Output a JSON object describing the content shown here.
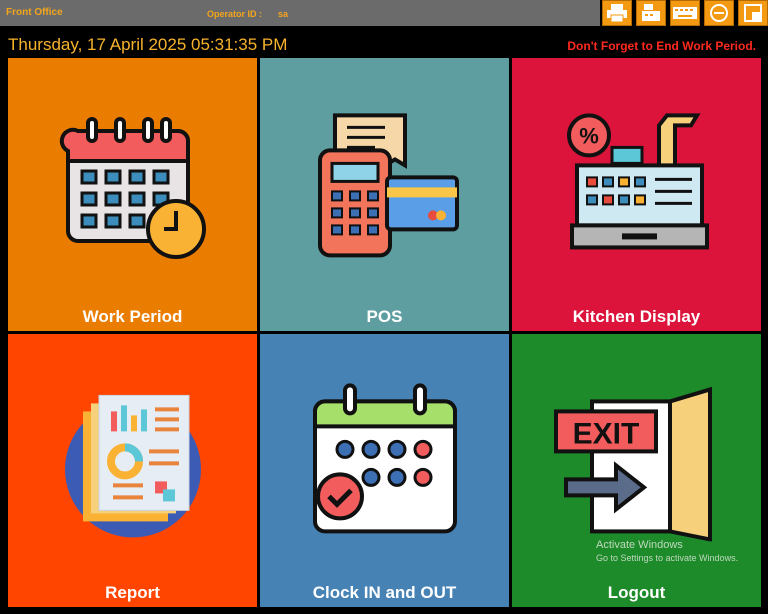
{
  "header": {
    "app_name": "Front Office",
    "operator_label": "Operator ID :",
    "operator_value": "sa",
    "datetime": "Thursday, 17 April 2025 05:31:35 PM",
    "warning": "Don't Forget to End Work Period."
  },
  "toolbar": [
    {
      "icon": "printer-icon"
    },
    {
      "icon": "cash-register-icon"
    },
    {
      "icon": "keyboard-icon"
    },
    {
      "icon": "minimize-icon"
    },
    {
      "icon": "restore-icon"
    }
  ],
  "tiles": [
    {
      "label": "Work Period",
      "color": "#ea7d00",
      "icon": "calendar-clock-icon"
    },
    {
      "label": "POS",
      "color": "#5f9ea0",
      "icon": "card-terminal-icon"
    },
    {
      "label": "Kitchen Display",
      "color": "#dc143c",
      "icon": "kitchen-register-icon"
    },
    {
      "label": "Report",
      "color": "#ff4500",
      "icon": "report-document-icon"
    },
    {
      "label": "Clock IN and OUT",
      "color": "#4682b4",
      "icon": "calendar-check-icon"
    },
    {
      "label": "Logout",
      "color": "#1e8b2a",
      "icon": "exit-door-icon"
    }
  ],
  "watermark": {
    "line1": "Activate Windows",
    "line2": "Go to Settings to activate Windows."
  }
}
